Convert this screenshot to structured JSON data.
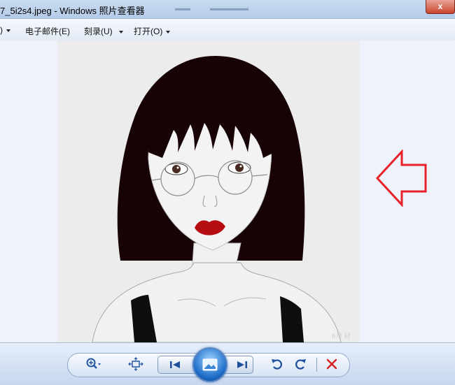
{
  "window": {
    "title": "7_5i2s4.jpeg - Windows 照片查看器",
    "close_glyph": "x"
  },
  "menu": {
    "items": [
      {
        "label": ")"
      },
      {
        "label": "电子邮件(E)"
      },
      {
        "label": "刻录(U)"
      },
      {
        "label": "打开(O)"
      }
    ]
  },
  "colors": {
    "annotation_arrow": "#e8222a",
    "hair": "#170306",
    "lips": "#b60d12",
    "delete_icon": "#d42121"
  },
  "image": {
    "signature": "6月 材"
  },
  "toolbar": {
    "icons": [
      "zoom-icon",
      "fit-to-window-icon",
      "previous-icon",
      "slideshow-icon",
      "next-icon",
      "rotate-counterclockwise-icon",
      "rotate-clockwise-icon",
      "delete-icon"
    ]
  }
}
